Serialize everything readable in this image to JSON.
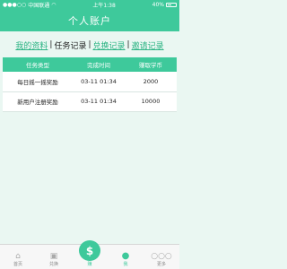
{
  "status_bar": {
    "carrier": "中国联通",
    "time": "上午1:38",
    "battery": "40%"
  },
  "header": {
    "title": "个人账户"
  },
  "tabs": [
    {
      "label": "我的资料"
    },
    {
      "label": "任务记录"
    },
    {
      "label": "兑换记录"
    },
    {
      "label": "邀请记录"
    }
  ],
  "table": {
    "headers": [
      "任务类型",
      "完成时间",
      "赚取学币"
    ],
    "rows": [
      [
        "每日摇一摇奖励",
        "03-11 01:34",
        "2000"
      ],
      [
        "新用户注册奖励",
        "03-11 01:34",
        "10000"
      ]
    ]
  },
  "bottom_nav": [
    {
      "label": "首页",
      "icon": "home-icon"
    },
    {
      "label": "兑换",
      "icon": "gift-icon"
    },
    {
      "label": "赚",
      "icon": "dollar-icon"
    },
    {
      "label": "我",
      "icon": "user-icon"
    },
    {
      "label": "更多",
      "icon": "more-icon"
    }
  ]
}
